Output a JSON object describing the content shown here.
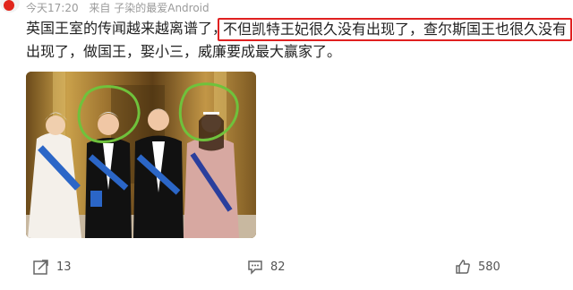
{
  "meta": {
    "time": "今天17:20",
    "source": "来自 子染的最爱Android"
  },
  "post": {
    "line1_prefix": "英国王室的传闻越来越离谱了，",
    "highlighted": "不但凯特王妃很久没有出现了，查尔斯国王也很久没有",
    "line2": "出现了，做国王，娶小三，威廉要成最大赢家了。"
  },
  "actions": {
    "share_count": "13",
    "comment_count": "82",
    "like_count": "580"
  },
  "colors": {
    "highlight_border": "#e02020",
    "circle": "#6fc23c",
    "sash": "#1f5fbf"
  },
  "icons": [
    "weibo-avatar-icon",
    "share-icon",
    "comment-icon",
    "like-icon"
  ]
}
